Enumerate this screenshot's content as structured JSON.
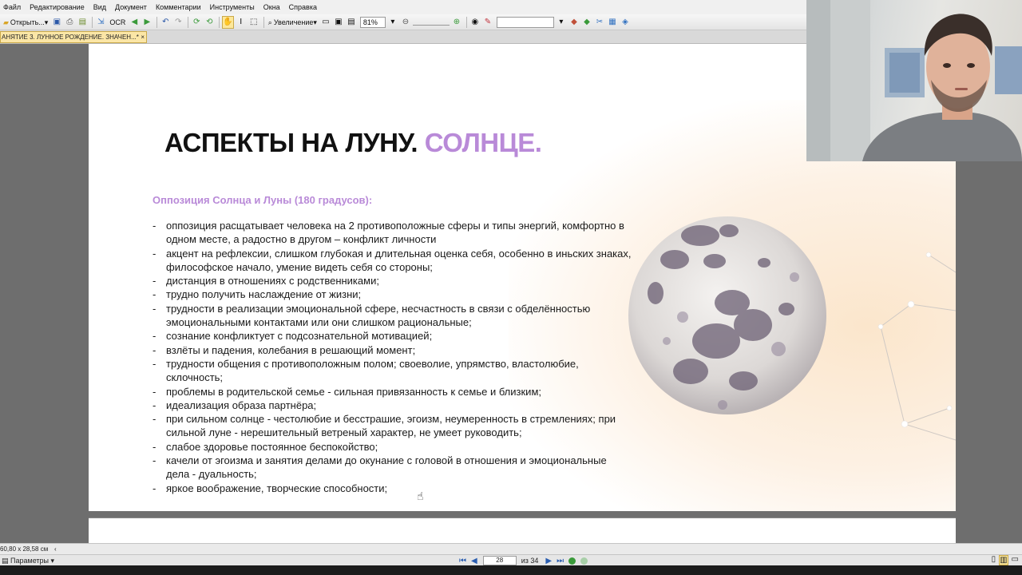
{
  "menu": [
    "Файл",
    "Редактирование",
    "Вид",
    "Документ",
    "Комментарии",
    "Инструменты",
    "Окна",
    "Справка"
  ],
  "toolbar": {
    "open_label": "Открыть...",
    "ocr_label": "OCR",
    "zoom_label": "Увеличение",
    "zoom_value": "81%"
  },
  "tab": {
    "title": "АНЯТИЕ 3. ЛУННОЕ РОЖДЕНИЕ. ЗНАЧЕН...*",
    "close": "×"
  },
  "slide": {
    "title_main": "АСПЕКТЫ НА ЛУНУ.",
    "title_accent": "СОЛНЦЕ.",
    "subtitle": "Оппозиция Солнца и Луны (180 градусов):",
    "bullets": [
      "оппозиция расщатывает человека на 2 противоположные сферы и типы энергий, комфортно в одном месте, а радостно в другом – конфликт личности",
      "акцент на рефлексии, слишком глубокая и длительная оценка себя, особенно в иньских знаках, философское начало, умение видеть себя со стороны;",
      "дистанция в отношениях с родственниками;",
      "трудно получить наслаждение от жизни;",
      "трудности в реализации эмоциональной сфере, несчастность в связи с обделённостью эмоциональными контактами или они слишком рациональные;",
      "сознание конфликтует с подсознательной мотивацией;",
      "взлёты и падения, колебания в решающий момент;",
      "трудности общения с противоположным полом; своеволие, упрямство, властолюбие, склочность;",
      "проблемы в родительской семье - сильная привязанность к семье и близким;",
      "идеализация образа партнёра;",
      "при сильном солнце - честолюбие и бесстрашие, эгоизм, неумеренность в стремлениях; при сильной луне - нерешительный ветреный характер, не умеет руководить;",
      "слабое здоровье постоянное беспокойство;",
      "качели от эгоизма и занятия делами до окунание с головой в отношения и эмоциональные дела - дуальность;",
      "яркое воображение, творческие способности;"
    ]
  },
  "status": {
    "page_size": "60,80 x 28,58 см",
    "params_label": "Параметры",
    "current_page": "28",
    "total_pages": "из 34"
  },
  "colors": {
    "accent": "#b98ad8",
    "tab_highlight": "#fbe6a6",
    "nav_blue": "#2a5db0"
  }
}
